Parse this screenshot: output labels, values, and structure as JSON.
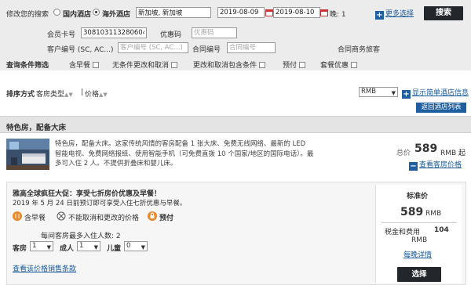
{
  "search": {
    "modify_label": "修改您的搜索",
    "domestic_label": "国内酒店",
    "overseas_label": "海外酒店",
    "destination": "新加坡, 新加坡",
    "checkin": "2019-08-09",
    "checkout": "2019-08-10",
    "nights_label": "晚: 1",
    "more_options": "更多选择",
    "search_button": "搜索",
    "member_card_label": "会员卡号",
    "member_card_value": "308103113280604",
    "promo_label": "优惠码",
    "promo_placeholder": "优惠码",
    "customer_no_label": "客户编号 (SC, AC...)",
    "customer_no_select": "客户编号 (SC, AC...)",
    "customer_no_placeholder": "客户编号 (SC, AC...)",
    "company_no_label": "合同编号",
    "company_no_placeholder": "合同编号",
    "corporate_label": "合同商务旅客",
    "filter_label": "查询条件筛选",
    "filters": [
      "含早餐",
      "无条件更改和取消",
      "更改和取消包含条件",
      "预付",
      "套餐优惠"
    ]
  },
  "sort": {
    "label": "排序方式",
    "room_type": "客房类型",
    "divider": "|",
    "price": "价格",
    "currency": "RMB",
    "show_simple": "显示简单酒店信息",
    "back_to_list": "返回酒店列表"
  },
  "room": {
    "title": "特色房，配备大床",
    "description": "特色房，配备大床。这家传统风情的客房配备 1 张大床、免费无线网络、最新的 LED 智能电视、免费网络报纸、使用智能手机（可免费直拨 10 个国家/地区的国际电话）。最多可入住 2 人。不提供折叠床和婴儿床。",
    "from_label": "总价",
    "from_price": "589",
    "from_currency": "RMB 起",
    "view_rates": "查看客房价格"
  },
  "offer": {
    "headline": "雅高全球疯狂大促：享受七折房价优惠及早餐！",
    "subline": "2019 年 5 月 24 日前预订即可享受入住七折优惠与早餐。",
    "features": [
      "含早餐",
      "不能取消和更改的价格",
      "预付"
    ],
    "max_occupancy": "每间客房最多入住人数: 2",
    "rooms_label": "客房",
    "rooms_value": "1",
    "adults_label": "成人",
    "adults_value": "1",
    "children_label": "儿童",
    "children_value": "0",
    "more_link": "查看该价格销售条款",
    "rate_type": "标准价",
    "price": "589",
    "price_currency": "RMB",
    "tax_label": "税金和费用",
    "tax_value": "104",
    "tax_currency": "RMB",
    "nightly_details": "每晚详情",
    "select_button": "选择"
  },
  "colors": {
    "header_bg": "#ececec",
    "dark_button": "#23262b",
    "link_blue": "#1a5a9a",
    "accent_orange": "#e8892a",
    "offer_bg": "#f6f6f6"
  }
}
